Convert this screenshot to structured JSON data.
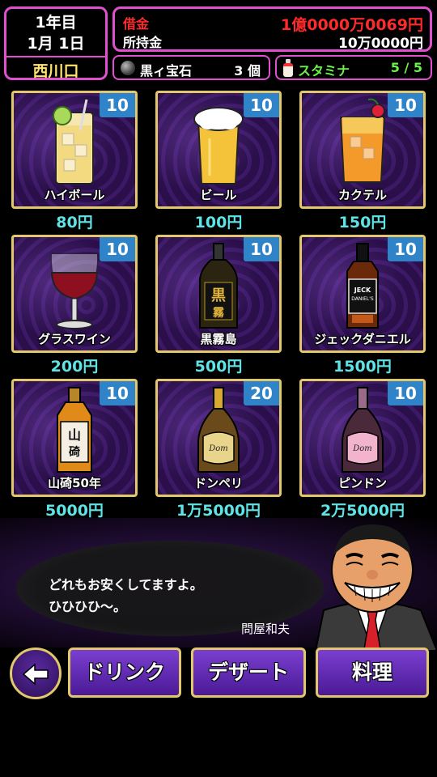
{
  "header": {
    "year": "1年目",
    "day": "1月 1日",
    "location": "西川口",
    "debt_label": "借金",
    "debt_value": "1億0000万0069円",
    "cash_label": "所持金",
    "cash_value": "10万0000円",
    "gem_icon": "black-gem-icon",
    "gem_label": "黒ィ宝石",
    "gem_count": "3 個",
    "stamina_icon": "stamina-drink-icon",
    "stamina_label": "スタミナ",
    "stamina_value": "5 / 5",
    "colors": {
      "frame": "#e04fcf",
      "debt": "#ff2a2a",
      "stamina": "#6cf14b",
      "location": "#ffe36a"
    }
  },
  "items": [
    {
      "name": "ハイボール",
      "price": "80円",
      "stock": "10",
      "icon": "highball-icon"
    },
    {
      "name": "ビール",
      "price": "100円",
      "stock": "10",
      "icon": "beer-icon"
    },
    {
      "name": "カクテル",
      "price": "150円",
      "stock": "10",
      "icon": "cocktail-icon"
    },
    {
      "name": "グラスワイン",
      "price": "200円",
      "stock": "10",
      "icon": "wine-glass-icon"
    },
    {
      "name": "黒霧島",
      "price": "500円",
      "stock": "10",
      "icon": "shochu-bottle-icon"
    },
    {
      "name": "ジェックダニエル",
      "price": "1500円",
      "stock": "10",
      "icon": "whiskey-bottle-icon"
    },
    {
      "name": "山碕50年",
      "price": "5000円",
      "stock": "10",
      "icon": "japanese-whisky-icon"
    },
    {
      "name": "ドンペリ",
      "price": "1万5000円",
      "stock": "20",
      "icon": "champagne-gold-icon"
    },
    {
      "name": "ピンドン",
      "price": "2万5000円",
      "stock": "10",
      "icon": "champagne-pink-icon"
    }
  ],
  "dialogue": {
    "line1": "どれもお安くしてますよ。",
    "line2": "ひひひひ〜。",
    "speaker": "問屋和夫"
  },
  "nav": {
    "back_icon": "back-arrow-icon",
    "drink": "ドリンク",
    "dessert": "デザート",
    "food": "料理"
  }
}
